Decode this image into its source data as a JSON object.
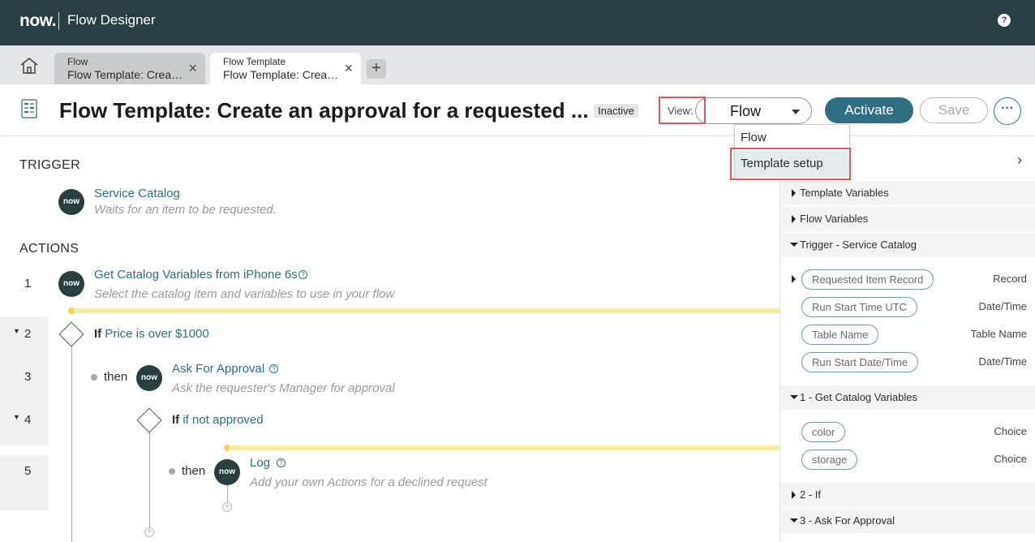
{
  "topbar": {
    "logo": "now.",
    "title": "Flow Designer",
    "help": "?"
  },
  "tabs": [
    {
      "type": "Flow",
      "name": "Flow Template: Create an approval"
    },
    {
      "type": "Flow Template",
      "name": "Flow Template: Create an approval"
    }
  ],
  "tab_close": "×",
  "add_tab": "+",
  "header": {
    "title": "Flow Template: Create an approval for a requested ...",
    "status": "Inactive",
    "view_label": "View:",
    "view_value": "Flow",
    "activate": "Activate",
    "save": "Save",
    "more": "···"
  },
  "view_options": [
    "Flow",
    "Template setup"
  ],
  "trigger": {
    "label": "TRIGGER",
    "title": "Service Catalog",
    "subtitle": "Waits for an item to be requested.",
    "icon_text": "now"
  },
  "actions": {
    "label": "ACTIONS",
    "steps": [
      {
        "num": "1",
        "title": "Get Catalog Variables from iPhone 6s",
        "subtitle": "Select the catalog item and variables to use in your flow"
      },
      {
        "num": "2",
        "if": "If",
        "condition": "Price is over $1000"
      },
      {
        "num": "3",
        "then": "then",
        "title": "Ask For Approval",
        "subtitle": "Ask the requester's Manager for approval"
      },
      {
        "num": "4",
        "if": "If",
        "condition": "if not approved"
      },
      {
        "num": "5",
        "then": "then",
        "title": "Log",
        "subtitle": "Add your own Actions for a declined request"
      }
    ]
  },
  "panel": {
    "sections": [
      {
        "label": "Template Variables",
        "expanded": false
      },
      {
        "label": "Flow Variables",
        "expanded": false
      },
      {
        "label": "Trigger - Service Catalog",
        "expanded": true
      },
      {
        "label": "1 - Get Catalog Variables",
        "expanded": true
      },
      {
        "label": "2 - If",
        "expanded": false
      },
      {
        "label": "3 - Ask For Approval",
        "expanded": true
      }
    ],
    "trigger_pills": [
      {
        "name": "Requested Item Record",
        "type": "Record"
      },
      {
        "name": "Run Start Time UTC",
        "type": "Date/Time"
      },
      {
        "name": "Table Name",
        "type": "Table Name"
      },
      {
        "name": "Run Start Date/Time",
        "type": "Date/Time"
      }
    ],
    "catalog_pills": [
      {
        "name": "color",
        "type": "Choice"
      },
      {
        "name": "storage",
        "type": "Choice"
      }
    ]
  },
  "colors": {
    "topbar": "#293e40",
    "accent": "#2f6f84",
    "highlight": "#e05a5a"
  }
}
